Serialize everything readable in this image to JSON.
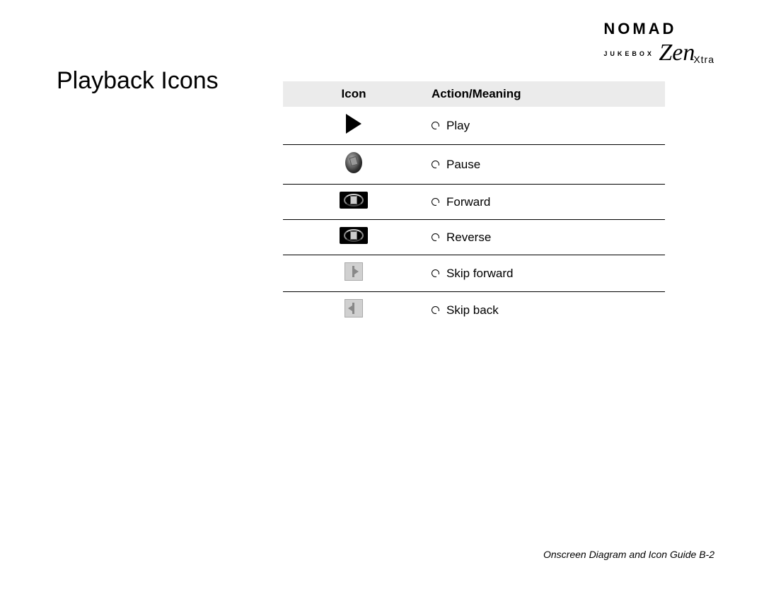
{
  "logo": {
    "line1": "NOMAD",
    "line2": "JUKEBOX",
    "zen": "Zen",
    "xtra": "Xtra"
  },
  "title": "Playback Icons",
  "table": {
    "headers": {
      "icon": "Icon",
      "meaning": "Action/Meaning"
    },
    "rows": [
      {
        "icon_name": "play-icon",
        "meaning": "Play"
      },
      {
        "icon_name": "pause-icon",
        "meaning": "Pause"
      },
      {
        "icon_name": "forward-icon",
        "meaning": "Forward"
      },
      {
        "icon_name": "reverse-icon",
        "meaning": "Reverse"
      },
      {
        "icon_name": "skip-forward-icon",
        "meaning": "Skip forward"
      },
      {
        "icon_name": "skip-back-icon",
        "meaning": "Skip back"
      }
    ]
  },
  "footer": "Onscreen Diagram and Icon Guide B-2"
}
